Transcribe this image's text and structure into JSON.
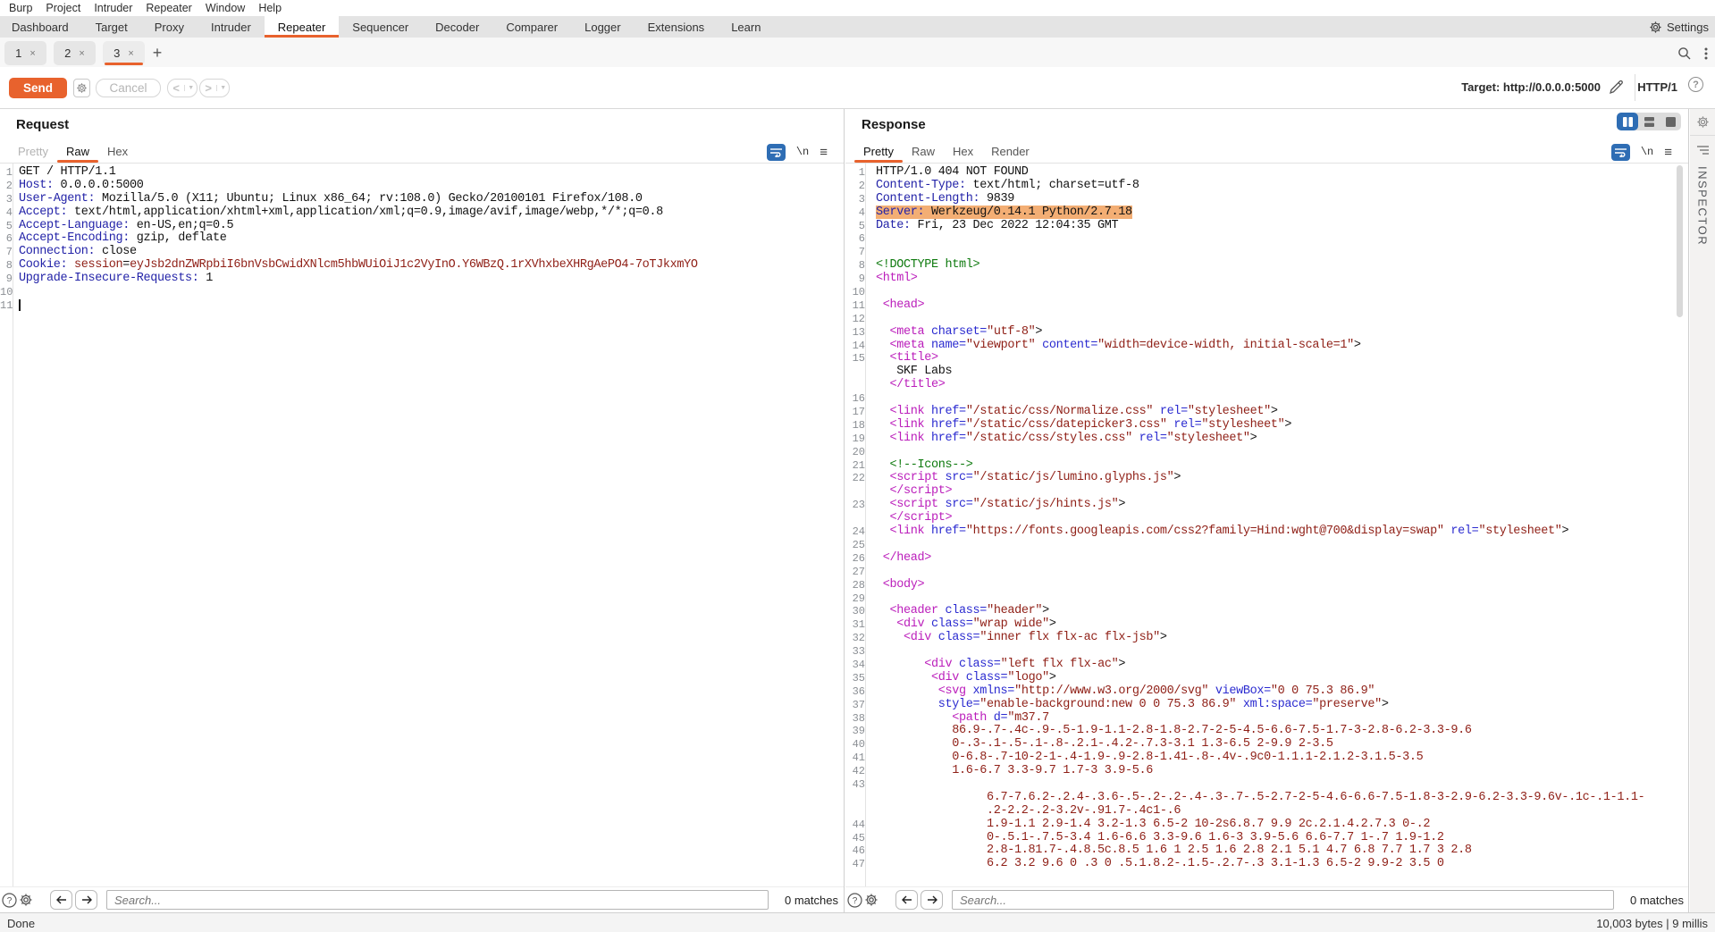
{
  "menu": {
    "items": [
      "Burp",
      "Project",
      "Intruder",
      "Repeater",
      "Window",
      "Help"
    ]
  },
  "tabs": {
    "items": [
      "Dashboard",
      "Target",
      "Proxy",
      "Intruder",
      "Repeater",
      "Sequencer",
      "Decoder",
      "Comparer",
      "Logger",
      "Extensions",
      "Learn"
    ],
    "selected": "Repeater",
    "settings_label": "Settings"
  },
  "subtabs": {
    "items": [
      {
        "label": "1"
      },
      {
        "label": "2"
      },
      {
        "label": "3",
        "selected": true
      }
    ],
    "close_glyph": "×",
    "add_glyph": "+"
  },
  "toolbar": {
    "send_label": "Send",
    "cancel_label": "Cancel",
    "prev_glyph": "<",
    "next_glyph": ">",
    "target_label": "Target: http://0.0.0.0:5000",
    "protocol_label": "HTTP/1",
    "help_glyph": "?"
  },
  "request": {
    "title": "Request",
    "tabs": [
      "Pretty",
      "Raw",
      "Hex"
    ],
    "selected_tab": "Raw",
    "disabled_tabs": [
      "Pretty"
    ],
    "newline_glyph": "\\n",
    "search_placeholder": "Search...",
    "matches": "0 matches",
    "lines": [
      {
        "n": "1",
        "t": [
          [
            "p",
            "GET / HTTP/1.1"
          ]
        ]
      },
      {
        "n": "2",
        "t": [
          [
            "h",
            "Host:"
          ],
          [
            "p",
            " 0.0.0.0:5000"
          ]
        ]
      },
      {
        "n": "3",
        "t": [
          [
            "h",
            "User-Agent:"
          ],
          [
            "p",
            " Mozilla/5.0 (X11; Ubuntu; Linux x86_64; rv:108.0) Gecko/20100101 Firefox/108.0"
          ]
        ]
      },
      {
        "n": "4",
        "t": [
          [
            "h",
            "Accept:"
          ],
          [
            "p",
            " text/html,application/xhtml+xml,application/xml;q=0.9,image/avif,image/webp,*/*;q=0.8"
          ]
        ]
      },
      {
        "n": "5",
        "t": [
          [
            "h",
            "Accept-Language:"
          ],
          [
            "p",
            " en-US,en;q=0.5"
          ]
        ]
      },
      {
        "n": "6",
        "t": [
          [
            "h",
            "Accept-Encoding:"
          ],
          [
            "p",
            " gzip, deflate"
          ]
        ]
      },
      {
        "n": "7",
        "t": [
          [
            "h",
            "Connection:"
          ],
          [
            "p",
            " close"
          ]
        ]
      },
      {
        "n": "8",
        "t": [
          [
            "h",
            "Cookie:"
          ],
          [
            "p",
            " "
          ],
          [
            "m",
            "session"
          ],
          [
            "p",
            "="
          ],
          [
            "m",
            "eyJsb2dnZWRpbiI6bnVsbCwidXNlcm5hbWUiOiJ1c2VyInO.Y6WBzQ.1rXVhxbeXHRgAePO4-7oTJkxmYO"
          ]
        ]
      },
      {
        "n": "9",
        "t": [
          [
            "h",
            "Upgrade-Insecure-Requests:"
          ],
          [
            "p",
            " 1"
          ]
        ]
      },
      {
        "n": "10",
        "t": []
      },
      {
        "n": "11",
        "t": [],
        "cur": true
      }
    ]
  },
  "response": {
    "title": "Response",
    "tabs": [
      "Pretty",
      "Raw",
      "Hex",
      "Render"
    ],
    "selected_tab": "Pretty",
    "disabled_tabs": [],
    "newline_glyph": "\\n",
    "search_placeholder": "Search...",
    "matches": "0 matches",
    "lines": [
      {
        "n": "1",
        "t": [
          [
            "p",
            "HTTP/1.0 404 NOT FOUND"
          ]
        ]
      },
      {
        "n": "2",
        "t": [
          [
            "h",
            "Content-Type:"
          ],
          [
            "p",
            " text/html; charset=utf-8"
          ]
        ]
      },
      {
        "n": "3",
        "t": [
          [
            "h",
            "Content-Length:"
          ],
          [
            "p",
            " 9839"
          ]
        ]
      },
      {
        "n": "4",
        "hl": true,
        "t": [
          [
            "h",
            "Server:"
          ],
          [
            "p",
            " Werkzeug/0.14.1 Python/2.7.18"
          ]
        ]
      },
      {
        "n": "5",
        "t": [
          [
            "h",
            "Date:"
          ],
          [
            "p",
            " Fri, 23 Dec 2022 12:04:35 GMT"
          ]
        ]
      },
      {
        "n": "6",
        "t": []
      },
      {
        "n": "7",
        "t": []
      },
      {
        "n": "8",
        "t": [
          [
            "c",
            "<!DOCTYPE html>"
          ]
        ]
      },
      {
        "n": "9",
        "t": [
          [
            "t",
            "<html>"
          ]
        ]
      },
      {
        "n": "10",
        "t": []
      },
      {
        "n": "11",
        "i": 1,
        "t": [
          [
            "t",
            "<head>"
          ]
        ]
      },
      {
        "n": "12",
        "t": []
      },
      {
        "n": "13",
        "i": 2,
        "t": [
          [
            "t",
            "<meta"
          ],
          [
            "p",
            " "
          ],
          [
            "a",
            "charset="
          ],
          [
            "v",
            "\"utf-8\""
          ],
          [
            "p",
            ">"
          ]
        ]
      },
      {
        "n": "14",
        "i": 2,
        "t": [
          [
            "t",
            "<meta"
          ],
          [
            "p",
            " "
          ],
          [
            "a",
            "name="
          ],
          [
            "v",
            "\"viewport\""
          ],
          [
            "p",
            " "
          ],
          [
            "a",
            "content="
          ],
          [
            "v",
            "\"width=device-width, initial-scale=1\""
          ],
          [
            "p",
            ">"
          ]
        ]
      },
      {
        "n": "15",
        "i": 2,
        "t": [
          [
            "t",
            "<title>"
          ]
        ]
      },
      {
        "i": 3,
        "t": [
          [
            "p",
            "SKF Labs"
          ]
        ]
      },
      {
        "i": 2,
        "t": [
          [
            "t",
            "</title>"
          ]
        ]
      },
      {
        "n": "16",
        "t": []
      },
      {
        "n": "17",
        "i": 2,
        "t": [
          [
            "t",
            "<link"
          ],
          [
            "p",
            " "
          ],
          [
            "a",
            "href="
          ],
          [
            "v",
            "\"/static/css/Normalize.css\""
          ],
          [
            "p",
            " "
          ],
          [
            "a",
            "rel="
          ],
          [
            "v",
            "\"stylesheet\""
          ],
          [
            "p",
            ">"
          ]
        ]
      },
      {
        "n": "18",
        "i": 2,
        "t": [
          [
            "t",
            "<link"
          ],
          [
            "p",
            " "
          ],
          [
            "a",
            "href="
          ],
          [
            "v",
            "\"/static/css/datepicker3.css\""
          ],
          [
            "p",
            " "
          ],
          [
            "a",
            "rel="
          ],
          [
            "v",
            "\"stylesheet\""
          ],
          [
            "p",
            ">"
          ]
        ]
      },
      {
        "n": "19",
        "i": 2,
        "t": [
          [
            "t",
            "<link"
          ],
          [
            "p",
            " "
          ],
          [
            "a",
            "href="
          ],
          [
            "v",
            "\"/static/css/styles.css\""
          ],
          [
            "p",
            " "
          ],
          [
            "a",
            "rel="
          ],
          [
            "v",
            "\"stylesheet\""
          ],
          [
            "p",
            ">"
          ]
        ]
      },
      {
        "n": "20",
        "t": []
      },
      {
        "n": "21",
        "i": 2,
        "t": [
          [
            "c",
            "<!--Icons-->"
          ]
        ]
      },
      {
        "n": "22",
        "i": 2,
        "t": [
          [
            "t",
            "<script"
          ],
          [
            "p",
            " "
          ],
          [
            "a",
            "src="
          ],
          [
            "v",
            "\"/static/js/lumino.glyphs.js\""
          ],
          [
            "p",
            ">"
          ]
        ]
      },
      {
        "i": 2,
        "t": [
          [
            "t",
            "</script>"
          ]
        ]
      },
      {
        "n": "23",
        "i": 2,
        "t": [
          [
            "t",
            "<script"
          ],
          [
            "p",
            " "
          ],
          [
            "a",
            "src="
          ],
          [
            "v",
            "\"/static/js/hints.js\""
          ],
          [
            "p",
            ">"
          ]
        ]
      },
      {
        "i": 2,
        "t": [
          [
            "t",
            "</script>"
          ]
        ]
      },
      {
        "n": "24",
        "i": 2,
        "t": [
          [
            "t",
            "<link"
          ],
          [
            "p",
            " "
          ],
          [
            "a",
            "href="
          ],
          [
            "v",
            "\"https://fonts.googleapis.com/css2?family=Hind:wght@700&display=swap\""
          ],
          [
            "p",
            " "
          ],
          [
            "a",
            "rel="
          ],
          [
            "v",
            "\"stylesheet\""
          ],
          [
            "p",
            ">"
          ]
        ]
      },
      {
        "n": "25",
        "t": []
      },
      {
        "n": "26",
        "i": 1,
        "t": [
          [
            "t",
            "</head>"
          ]
        ]
      },
      {
        "n": "27",
        "t": []
      },
      {
        "n": "28",
        "i": 1,
        "t": [
          [
            "t",
            "<body>"
          ]
        ]
      },
      {
        "n": "29",
        "t": []
      },
      {
        "n": "30",
        "i": 2,
        "t": [
          [
            "t",
            "<header"
          ],
          [
            "p",
            " "
          ],
          [
            "a",
            "class="
          ],
          [
            "v",
            "\"header\""
          ],
          [
            "p",
            ">"
          ]
        ]
      },
      {
        "n": "31",
        "i": 3,
        "t": [
          [
            "t",
            "<div"
          ],
          [
            "p",
            " "
          ],
          [
            "a",
            "class="
          ],
          [
            "v",
            "\"wrap wide\""
          ],
          [
            "p",
            ">"
          ]
        ]
      },
      {
        "n": "32",
        "i": 4,
        "t": [
          [
            "t",
            "<div"
          ],
          [
            "p",
            " "
          ],
          [
            "a",
            "class="
          ],
          [
            "v",
            "\"inner flx flx-ac flx-jsb\""
          ],
          [
            "p",
            ">"
          ]
        ]
      },
      {
        "n": "33",
        "t": []
      },
      {
        "n": "34",
        "i": 7,
        "t": [
          [
            "t",
            "<div"
          ],
          [
            "p",
            " "
          ],
          [
            "a",
            "class="
          ],
          [
            "v",
            "\"left flx flx-ac\""
          ],
          [
            "p",
            ">"
          ]
        ]
      },
      {
        "n": "35",
        "i": 8,
        "t": [
          [
            "t",
            "<div"
          ],
          [
            "p",
            " "
          ],
          [
            "a",
            "class="
          ],
          [
            "v",
            "\"logo\""
          ],
          [
            "p",
            ">"
          ]
        ]
      },
      {
        "n": "36",
        "i": 9,
        "t": [
          [
            "t",
            "<svg"
          ],
          [
            "p",
            " "
          ],
          [
            "a",
            "xmlns="
          ],
          [
            "v",
            "\"http://www.w3.org/2000/svg\""
          ],
          [
            "p",
            " "
          ],
          [
            "a",
            "viewBox="
          ],
          [
            "v",
            "\"0 0 75.3 86.9\""
          ]
        ]
      },
      {
        "n": "37",
        "i": 9,
        "t": [
          [
            "a",
            "style="
          ],
          [
            "v",
            "\"enable-background:new 0 0 75.3 86.9\""
          ],
          [
            "p",
            " "
          ],
          [
            "a",
            "xml:space="
          ],
          [
            "v",
            "\"preserve\""
          ],
          [
            "p",
            ">"
          ]
        ]
      },
      {
        "n": "38",
        "i": 11,
        "t": [
          [
            "t",
            "<path"
          ],
          [
            "p",
            " "
          ],
          [
            "a",
            "d="
          ],
          [
            "v",
            "\"m37.7"
          ]
        ]
      },
      {
        "n": "39",
        "i": 11,
        "t": [
          [
            "v",
            "86.9-.7-.4c-.9-.5-1.9-1.1-2.8-1.8-2.7-2-5-4.5-6.6-7.5-1.7-3-2.8-6.2-3.3-9.6"
          ]
        ]
      },
      {
        "n": "40",
        "i": 11,
        "t": [
          [
            "v",
            "0-.3-.1-.5-.1-.8-.2.1-.4.2-.7.3-3.1 1.3-6.5 2-9.9 2-3.5"
          ]
        ]
      },
      {
        "n": "41",
        "i": 11,
        "t": [
          [
            "v",
            "0-6.8-.7-10-2-1-.4-1.9-.9-2.8-1.41-.8-.4v-.9c0-1.1.1-2.1.2-3.1.5-3.5"
          ]
        ]
      },
      {
        "n": "42",
        "i": 11,
        "t": [
          [
            "v",
            "1.6-6.7 3.3-9.7 1.7-3 3.9-5.6"
          ]
        ]
      },
      {
        "n": "43",
        "t": []
      },
      {
        "i": 16,
        "t": [
          [
            "v",
            "6.7-7.6.2-.2.4-.3.6-.5-.2-.2-.4-.3-.7-.5-2.7-2-5-4.6-6.6-7.5-1.8-3-2.9-6.2-3.3-9.6v-.1c-.1-1.1-"
          ]
        ]
      },
      {
        "i": 16,
        "t": [
          [
            "v",
            ".2-2.2-.2-3.2v-.91.7-.4c1-.6"
          ]
        ]
      },
      {
        "n": "44",
        "i": 16,
        "t": [
          [
            "v",
            "1.9-1.1 2.9-1.4 3.2-1.3 6.5-2 10-2s6.8.7 9.9 2c.2.1.4.2.7.3 0-.2"
          ]
        ]
      },
      {
        "n": "45",
        "i": 16,
        "t": [
          [
            "v",
            "0-.5.1-.7.5-3.4 1.6-6.6 3.3-9.6 1.6-3 3.9-5.6 6.6-7.7 1-.7 1.9-1.2"
          ]
        ]
      },
      {
        "n": "46",
        "i": 16,
        "t": [
          [
            "v",
            "2.8-1.81.7-.4.8.5c.8.5 1.6 1 2.5 1.6 2.8 2.1 5.1 4.7 6.8 7.7 1.7 3 2.8"
          ]
        ]
      },
      {
        "n": "47",
        "i": 16,
        "t": [
          [
            "v",
            "6.2 3.2 9.6 0 .3 0 .5.1.8.2-.1.5-.2.7-.3 3.1-1.3 6.5-2 9.9-2 3.5 0"
          ]
        ]
      }
    ]
  },
  "inspector": {
    "label": "INSPECTOR"
  },
  "status": {
    "left": "Done",
    "right": "10,003 bytes | 9 millis"
  },
  "colors": {
    "accent_orange": "#e8622d",
    "selected_blue": "#2e6db4",
    "highlight": "#f3ae74",
    "header_name": "#2323a8",
    "tag": "#bb1ebb",
    "attr_name": "#2b2bd0",
    "attr_value": "#8f1f16",
    "comment": "#0e7a0e"
  }
}
